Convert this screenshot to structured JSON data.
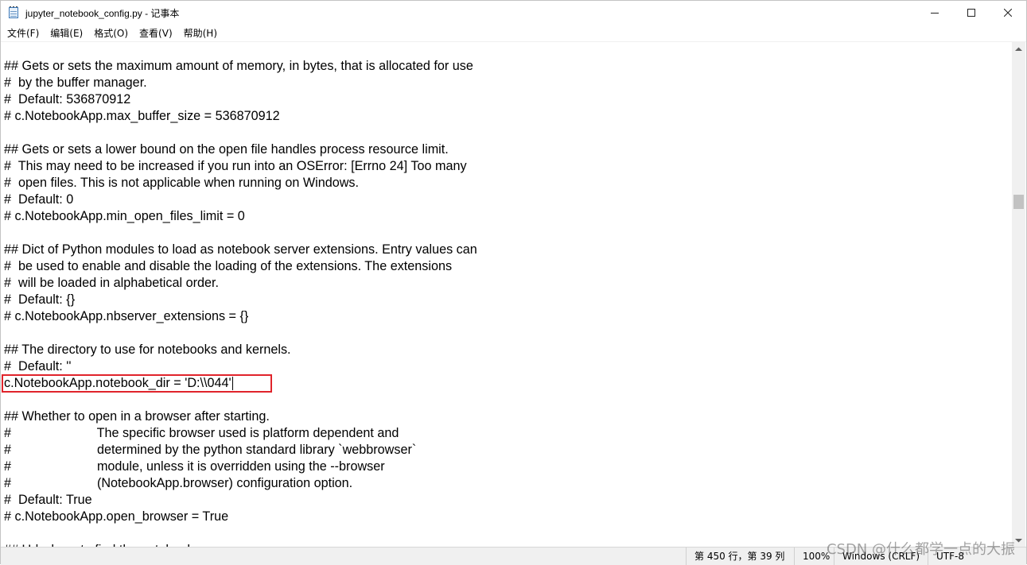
{
  "window": {
    "title": "jupyter_notebook_config.py - 记事本"
  },
  "menu": {
    "items": [
      "文件(F)",
      "编辑(E)",
      "格式(O)",
      "查看(V)",
      "帮助(H)"
    ]
  },
  "editor": {
    "lines": [
      "## Gets or sets the maximum amount of memory, in bytes, that is allocated for use",
      "#  by the buffer manager.",
      "#  Default: 536870912",
      "# c.NotebookApp.max_buffer_size = 536870912",
      "",
      "## Gets or sets a lower bound on the open file handles process resource limit.",
      "#  This may need to be increased if you run into an OSError: [Errno 24] Too many",
      "#  open files. This is not applicable when running on Windows.",
      "#  Default: 0",
      "# c.NotebookApp.min_open_files_limit = 0",
      "",
      "## Dict of Python modules to load as notebook server extensions. Entry values can",
      "#  be used to enable and disable the loading of the extensions. The extensions",
      "#  will be loaded in alphabetical order.",
      "#  Default: {}",
      "# c.NotebookApp.nbserver_extensions = {}",
      "",
      "## The directory to use for notebooks and kernels.",
      "#  Default: ''",
      "c.NotebookApp.notebook_dir = 'D:\\\\044'",
      "",
      "## Whether to open in a browser after starting.",
      "#                        The specific browser used is platform dependent and",
      "#                        determined by the python standard library `webbrowser`",
      "#                        module, unless it is overridden using the --browser",
      "#                        (NotebookApp.browser) configuration option.",
      "#  Default: True",
      "# c.NotebookApp.open_browser = True",
      "",
      "## Url where to find the notebook"
    ],
    "highlighted_line_index": 19
  },
  "status": {
    "position": "第 450 行，第 39 列",
    "zoom": "100%",
    "line_ending": "Windows (CRLF)",
    "encoding": "UTF-8"
  },
  "watermark": "CSDN @什么都学一点的大振",
  "colors": {
    "highlight_border": "#e0242b",
    "statusbar_bg": "#f0f0f0"
  }
}
